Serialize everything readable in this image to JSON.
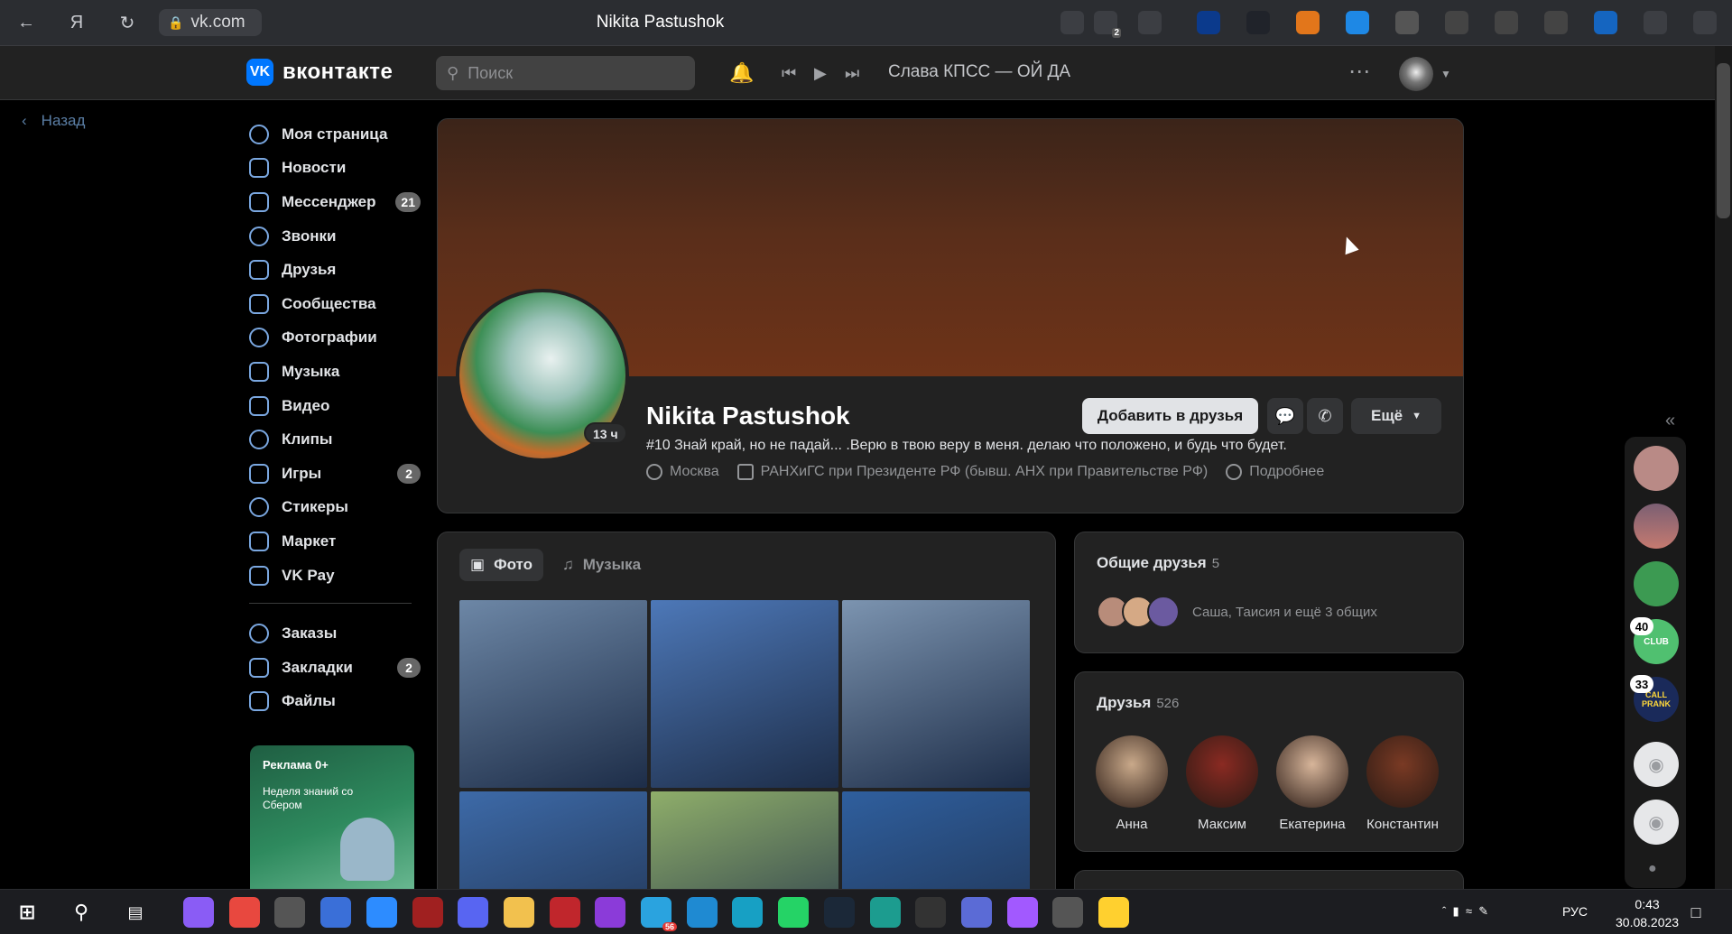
{
  "browser": {
    "tab_title": "Nikita Pastushok",
    "url": "vk.com",
    "extensions": [
      {
        "icon": "puzzle-icon",
        "color": "#3c3e43"
      },
      {
        "icon": "screenshot-icon",
        "color": "#3c3e43",
        "badge": "2"
      },
      {
        "icon": "bookmark-icon",
        "color": "#3c3e43"
      },
      {
        "icon": "search-icon",
        "color": "#0b3a8c"
      },
      {
        "icon": "react-icon",
        "color": "#20232a"
      },
      {
        "icon": "metamask-icon",
        "color": "#e2761b"
      },
      {
        "icon": "vpn-icon",
        "color": "#1e88e5"
      },
      {
        "icon": "gitzip-icon",
        "color": "#555"
      },
      {
        "icon": "target-icon",
        "color": "#444"
      },
      {
        "icon": "cs-icon",
        "color": "#444"
      },
      {
        "icon": "bug-icon",
        "color": "#444"
      },
      {
        "icon": "translate-icon",
        "color": "#1565c0"
      },
      {
        "icon": "collections-icon",
        "color": "#3c3e43"
      },
      {
        "icon": "download-icon",
        "color": "#3c3e43"
      }
    ]
  },
  "header": {
    "logo_text": "вконтакте",
    "search_placeholder": "Поиск",
    "now_playing": "Слава КПСС — ОЙ ДА"
  },
  "back_label": "Назад",
  "nav": {
    "items": [
      {
        "label": "Моя страница",
        "icon": "user-icon"
      },
      {
        "label": "Новости",
        "icon": "news-icon"
      },
      {
        "label": "Мессенджер",
        "icon": "message-icon",
        "badge": "21"
      },
      {
        "label": "Звонки",
        "icon": "phone-icon"
      },
      {
        "label": "Друзья",
        "icon": "friends-icon"
      },
      {
        "label": "Сообщества",
        "icon": "communities-icon"
      },
      {
        "label": "Фотографии",
        "icon": "photo-icon"
      },
      {
        "label": "Музыка",
        "icon": "music-icon"
      },
      {
        "label": "Видео",
        "icon": "video-icon"
      },
      {
        "label": "Клипы",
        "icon": "clips-icon"
      },
      {
        "label": "Игры",
        "icon": "games-icon",
        "badge": "2"
      }
    ],
    "items2": [
      {
        "label": "Стикеры",
        "icon": "sticker-icon"
      },
      {
        "label": "Маркет",
        "icon": "market-icon"
      },
      {
        "label": "VK Pay",
        "icon": "vkpay-icon"
      }
    ],
    "items3": [
      {
        "label": "Заказы",
        "icon": "orders-icon"
      },
      {
        "label": "Закладки",
        "icon": "bookmarks-icon",
        "badge": "2"
      },
      {
        "label": "Файлы",
        "icon": "files-icon"
      }
    ],
    "ad_label": "Реклама 0+",
    "ad_title": "Неделя знаний со Сбером"
  },
  "profile": {
    "name": "Nikita Pastushok",
    "online": "13 ч",
    "status": "#10 Знай край, но не падай... .Верю в твою веру в меня. делаю что положено, и будь что будет.",
    "city": "Москва",
    "work": "РАНХиГС при Президенте РФ (бывш. АНХ при Правительстве РФ)",
    "details_label": "Подробнее",
    "add_friend_label": "Добавить в друзья",
    "more_label": "Ещё"
  },
  "media_tabs": {
    "photo_label": "Фото",
    "music_label": "Музыка"
  },
  "photos": [
    "#6d87a6",
    "#4d78b8",
    "#7c94b0",
    "#3d6aa8",
    "#8fae6a",
    "#2f5f9e"
  ],
  "mutual": {
    "title": "Общие друзья",
    "count": "5",
    "text": "Саша, Таисия и ещё 3 общих"
  },
  "friends": {
    "title": "Друзья",
    "count": "526",
    "list": [
      {
        "name": "Анна",
        "color": "#c9a98a"
      },
      {
        "name": "Максим",
        "color": "#8a2a22"
      },
      {
        "name": "Екатерина",
        "color": "#d7b59a"
      },
      {
        "name": "Константин",
        "color": "#7a3a24"
      }
    ]
  },
  "rail": {
    "badges": [
      "40",
      "33"
    ],
    "labels": [
      "CLUB",
      "CALL PRANK"
    ]
  },
  "taskbar": {
    "lang": "РУС",
    "time": "0:43",
    "date": "30.08.2023",
    "telegram_badge": "56"
  }
}
